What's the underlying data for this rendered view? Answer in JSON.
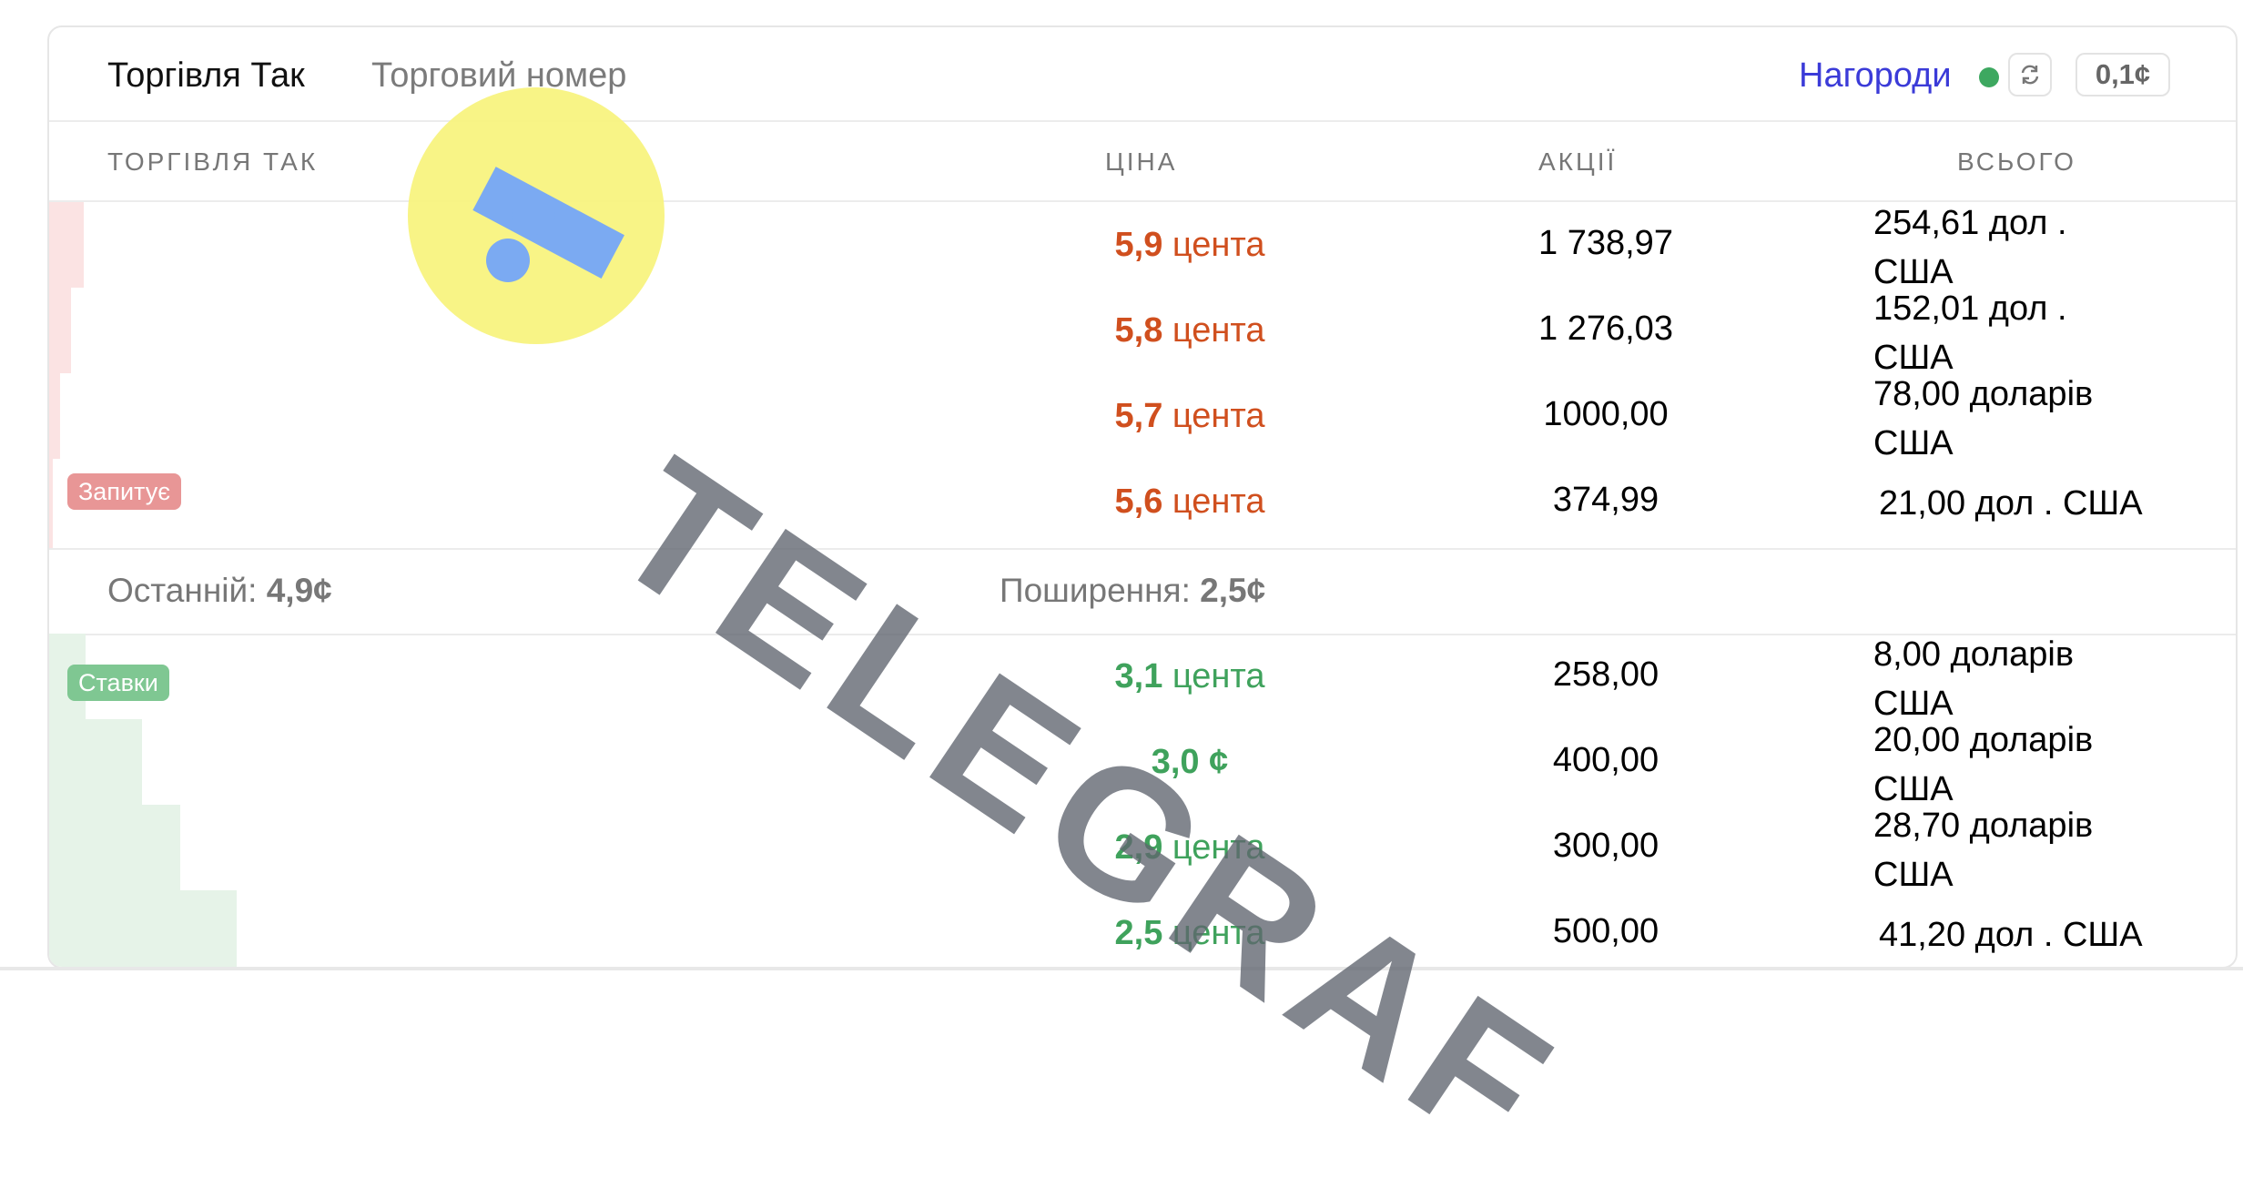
{
  "tabs": {
    "active": "Торгівля Так",
    "inactive": "Торговий номер"
  },
  "header_controls": {
    "rewards": "Нагороди",
    "tick": "0,1¢"
  },
  "columns": {
    "side": "ТОРГІВЛЯ ТАК",
    "price": "ЦІНА",
    "shares": "АКЦІЇ",
    "total": "ВСЬОГО"
  },
  "asks": [
    {
      "price_num": "5,9",
      "price_unit": "цента",
      "shares": "1 738,97",
      "total_1": "254,61 дол .",
      "total_2": "США"
    },
    {
      "price_num": "5,8",
      "price_unit": "цента",
      "shares": "1 276,03",
      "total_1": "152,01 дол .",
      "total_2": "США"
    },
    {
      "price_num": "5,7",
      "price_unit": "цента",
      "shares": "1000,00",
      "total_1": "78,00 доларів",
      "total_2": "США"
    },
    {
      "price_num": "5,6",
      "price_unit": "цента",
      "shares": "374,99",
      "total_1": "21,00 дол . США",
      "total_2": ""
    }
  ],
  "ask_badge": "Запитує",
  "mid": {
    "last_label": "Останній:",
    "last_value": "4,9¢",
    "spread_label": "Поширення:",
    "spread_value": "2,5¢"
  },
  "bids": [
    {
      "price_num": "3,1",
      "price_unit": "цента",
      "shares": "258,00",
      "total_1": "8,00 доларів",
      "total_2": "США"
    },
    {
      "price_num": "3,0",
      "price_unit": "¢",
      "shares": "400,00",
      "total_1": "20,00 доларів",
      "total_2": "США"
    },
    {
      "price_num": "2,9",
      "price_unit": "цента",
      "shares": "300,00",
      "total_1": "28,70 доларів",
      "total_2": "США"
    },
    {
      "price_num": "2,5",
      "price_unit": "цента",
      "shares": "500,00",
      "total_1": "41,20 дол . США",
      "total_2": ""
    }
  ],
  "bid_badge": "Ставки",
  "watermark": "TELEGRAF",
  "colors": {
    "ask": "#d04f1e",
    "bid": "#3fa25c",
    "rewards": "#3b3bd8"
  }
}
